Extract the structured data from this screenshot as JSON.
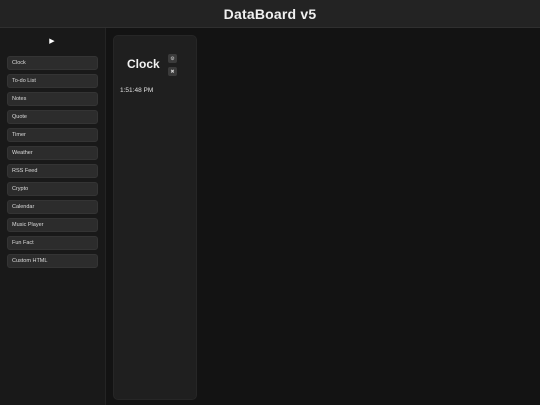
{
  "header": {
    "title": "DataBoard v5"
  },
  "sidebar": {
    "toggle_glyph": "▶",
    "items": [
      {
        "label": "Clock"
      },
      {
        "label": "To-do List"
      },
      {
        "label": "Notes"
      },
      {
        "label": "Quote"
      },
      {
        "label": "Timer"
      },
      {
        "label": "Weather"
      },
      {
        "label": "RSS Feed"
      },
      {
        "label": "Crypto"
      },
      {
        "label": "Calendar"
      },
      {
        "label": "Music Player"
      },
      {
        "label": "Fun Fact"
      },
      {
        "label": "Custom HTML"
      }
    ]
  },
  "clock_widget": {
    "title": "Clock",
    "settings_glyph": "⚙",
    "close_glyph": "✖",
    "time": "1:51:48 PM"
  }
}
